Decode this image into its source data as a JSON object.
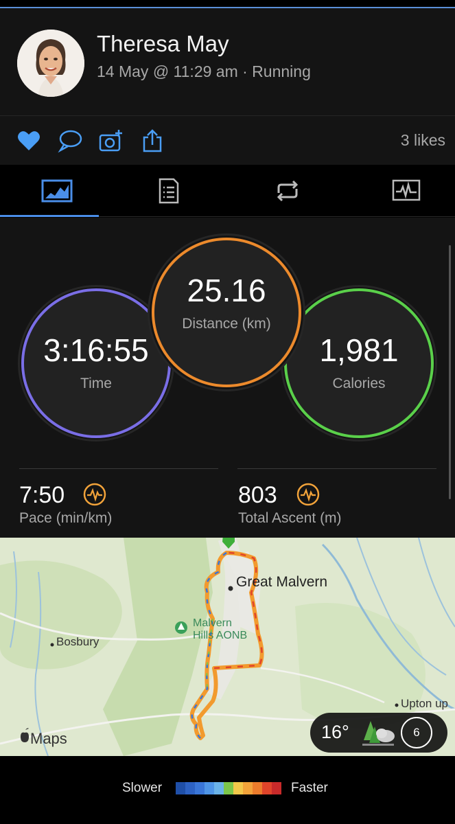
{
  "profile": {
    "name": "Theresa May",
    "meta": "14 May @ 11:29 am · Running"
  },
  "actions": {
    "likes": "3 likes",
    "like_color": "#4a9ef5"
  },
  "tabs": [
    {
      "name": "overview",
      "icon": "overview-chart-icon",
      "active": true
    },
    {
      "name": "details",
      "icon": "document-list-icon",
      "active": false
    },
    {
      "name": "laps",
      "icon": "repeat-icon",
      "active": false
    },
    {
      "name": "charts",
      "icon": "activity-chart-icon",
      "active": false
    }
  ],
  "stats": {
    "time": {
      "value": "3:16:55",
      "label": "Time",
      "color": "#6e6ee8"
    },
    "distance": {
      "value": "25.16",
      "label": "Distance (km)",
      "color": "#ec8a2c"
    },
    "calories": {
      "value": "1,981",
      "label": "Calories",
      "color": "#5ad04a"
    },
    "pace": {
      "value": "7:50",
      "label": "Pace (min/km)"
    },
    "ascent": {
      "value": "803",
      "label": "Total Ascent (m)"
    }
  },
  "map": {
    "places": [
      "Great Malvern",
      "Malvern",
      "Hills AONB",
      "Bosbury",
      "Upton up"
    ],
    "attribution": "Maps",
    "weather": {
      "temp": "16°",
      "wind": "6"
    }
  },
  "legend": {
    "slower": "Slower",
    "faster": "Faster",
    "colors": [
      "#1f4fa8",
      "#2d62c4",
      "#3a76d8",
      "#4f95e6",
      "#6bb3e8",
      "#7cc64a",
      "#f2c84a",
      "#f2a33a",
      "#ec7c2c",
      "#e0442a",
      "#c82a2a"
    ]
  }
}
